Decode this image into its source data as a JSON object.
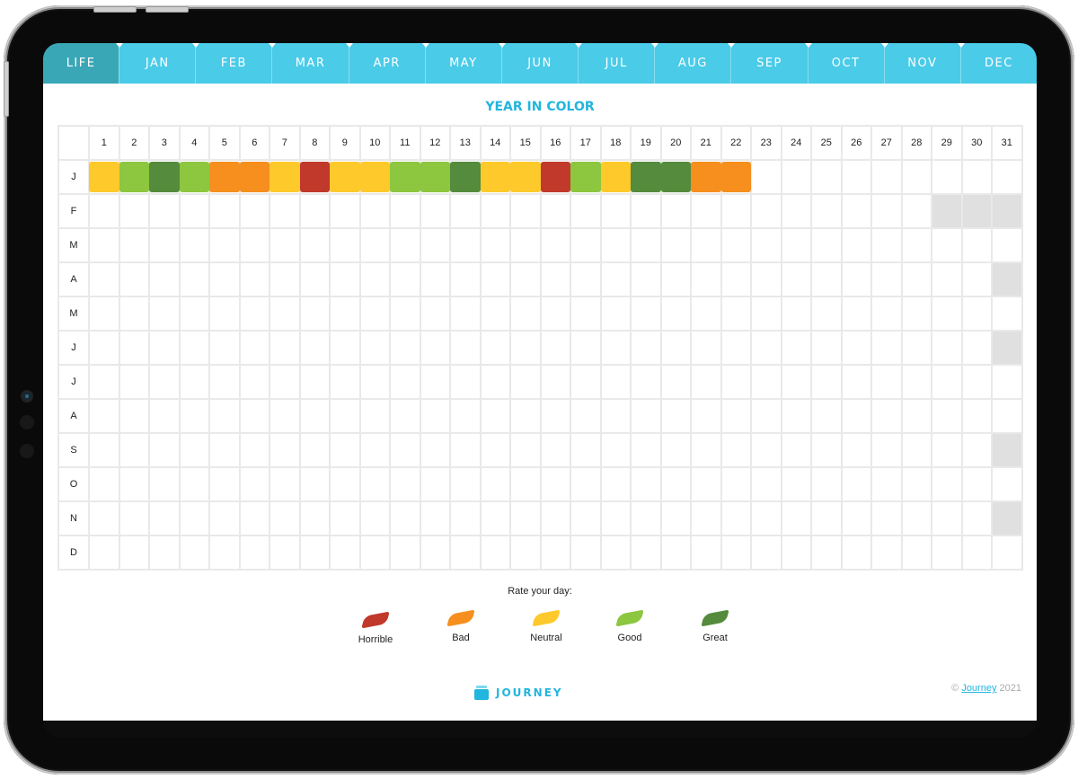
{
  "tabs": [
    {
      "label": "LIFE",
      "active": true
    },
    {
      "label": "JAN"
    },
    {
      "label": "FEB"
    },
    {
      "label": "MAR"
    },
    {
      "label": "APR"
    },
    {
      "label": "MAY"
    },
    {
      "label": "JUN"
    },
    {
      "label": "JUL"
    },
    {
      "label": "AUG"
    },
    {
      "label": "SEP"
    },
    {
      "label": "OCT"
    },
    {
      "label": "NOV"
    },
    {
      "label": "DEC"
    }
  ],
  "title": "YEAR IN COLOR",
  "days": [
    "1",
    "2",
    "3",
    "4",
    "5",
    "6",
    "7",
    "8",
    "9",
    "10",
    "11",
    "12",
    "13",
    "14",
    "15",
    "16",
    "17",
    "18",
    "19",
    "20",
    "21",
    "22",
    "23",
    "24",
    "25",
    "26",
    "27",
    "28",
    "29",
    "30",
    "31"
  ],
  "months": [
    {
      "label": "J",
      "days_in_month": 31,
      "ratings": [
        "neutral",
        "good",
        "great",
        "good",
        "bad",
        "bad",
        "neutral",
        "horrible",
        "neutral",
        "neutral",
        "good",
        "good",
        "great",
        "neutral",
        "neutral",
        "horrible",
        "good",
        "neutral",
        "great",
        "great",
        "bad",
        "bad"
      ]
    },
    {
      "label": "F",
      "days_in_month": 28,
      "ratings": []
    },
    {
      "label": "M",
      "days_in_month": 31,
      "ratings": []
    },
    {
      "label": "A",
      "days_in_month": 30,
      "ratings": []
    },
    {
      "label": "M",
      "days_in_month": 31,
      "ratings": []
    },
    {
      "label": "J",
      "days_in_month": 30,
      "ratings": []
    },
    {
      "label": "J",
      "days_in_month": 31,
      "ratings": []
    },
    {
      "label": "A",
      "days_in_month": 31,
      "ratings": []
    },
    {
      "label": "S",
      "days_in_month": 30,
      "ratings": []
    },
    {
      "label": "O",
      "days_in_month": 31,
      "ratings": []
    },
    {
      "label": "N",
      "days_in_month": 30,
      "ratings": []
    },
    {
      "label": "D",
      "days_in_month": 31,
      "ratings": []
    }
  ],
  "legend": {
    "title": "Rate your day:",
    "items": [
      {
        "key": "horrible",
        "label": "Horrible",
        "color": "#c0392b"
      },
      {
        "key": "bad",
        "label": "Bad",
        "color": "#f68f1e"
      },
      {
        "key": "neutral",
        "label": "Neutral",
        "color": "#fec92b"
      },
      {
        "key": "good",
        "label": "Good",
        "color": "#8dc63f"
      },
      {
        "key": "great",
        "label": "Great",
        "color": "#548b3c"
      }
    ]
  },
  "brand": {
    "name": "JOURNEY"
  },
  "footer": {
    "symbol": "©",
    "link_text": "Journey",
    "year": "2021"
  },
  "colors": {
    "accent": "#22b5dd",
    "tab_bar": "#4acbe8",
    "tab_active": "#3aa7b7",
    "unavailable": "#e0e0e0"
  }
}
